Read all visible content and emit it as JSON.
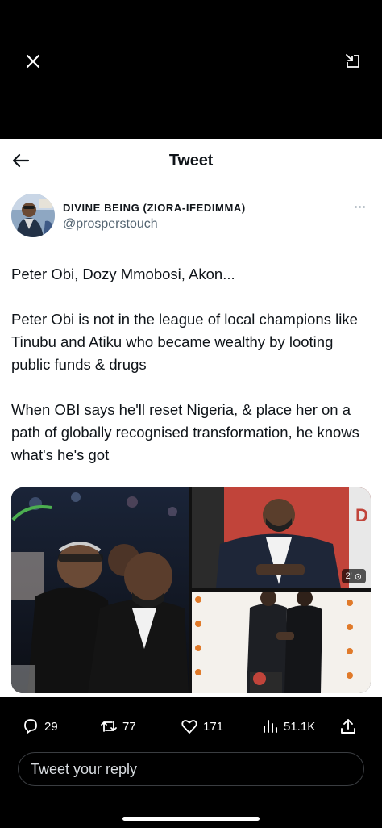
{
  "viewer": {
    "close_icon": "close-icon",
    "minimize_icon": "minimize-icon"
  },
  "header": {
    "title": "Tweet",
    "back_icon": "back-arrow-icon"
  },
  "author": {
    "display_name": "DIVINE BEING (ZIORA-IFEDIMMA)",
    "handle": "@prosperstouch"
  },
  "tweet": {
    "paragraphs": [
      "Peter Obi, Dozy Mmobosi, Akon...",
      "Peter Obi is not in the league of local champions like Tinubu and Atiku who became wealthy by looting public funds & drugs",
      "When OBI says he'll reset Nigeria, & place her on a path of globally recognised transformation, he knows what's he's got"
    ],
    "media": {
      "gif_duration": "2'",
      "image_count": 3
    }
  },
  "actions": {
    "replies": "29",
    "retweets": "77",
    "likes": "171",
    "views": "51.1K"
  },
  "reply": {
    "placeholder": "Tweet your reply"
  },
  "colors": {
    "text_primary": "#0f1419",
    "text_secondary": "#536471",
    "background_dark": "#000000",
    "panel": "#ffffff"
  }
}
